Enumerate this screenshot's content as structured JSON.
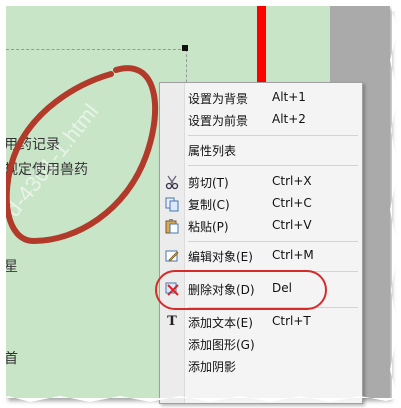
{
  "document": {
    "lines": [
      "用药记录",
      "规定使用兽药",
      "星",
      "首"
    ],
    "watermark": "d-4301-1.html"
  },
  "context_menu": {
    "items": [
      {
        "label": "设置为背景",
        "shortcut": "Alt+1",
        "icon": "none"
      },
      {
        "label": "设置为前景",
        "shortcut": "Alt+2",
        "icon": "none"
      },
      {
        "label": "属性列表",
        "shortcut": "",
        "icon": "none"
      },
      {
        "label": "剪切(T)",
        "shortcut": "Ctrl+X",
        "icon": "scissors-icon"
      },
      {
        "label": "复制(C)",
        "shortcut": "Ctrl+C",
        "icon": "copy-icon"
      },
      {
        "label": "粘贴(P)",
        "shortcut": "Ctrl+V",
        "icon": "paste-icon"
      },
      {
        "label": "编辑对象(E)",
        "shortcut": "Ctrl+M",
        "icon": "edit-icon"
      },
      {
        "label": "删除对象(D)",
        "shortcut": "Del",
        "icon": "delete-icon"
      },
      {
        "label": "添加文本(E)",
        "shortcut": "Ctrl+T",
        "icon": "text-icon"
      },
      {
        "label": "添加图形(G)",
        "shortcut": "",
        "icon": "none"
      },
      {
        "label": "添加阴影",
        "shortcut": "",
        "icon": "none"
      }
    ]
  },
  "colors": {
    "canvas": "#c9e5c8",
    "red_bar": "#ff0000",
    "annotation": "#b23a2b",
    "highlight": "#d62b2b"
  }
}
